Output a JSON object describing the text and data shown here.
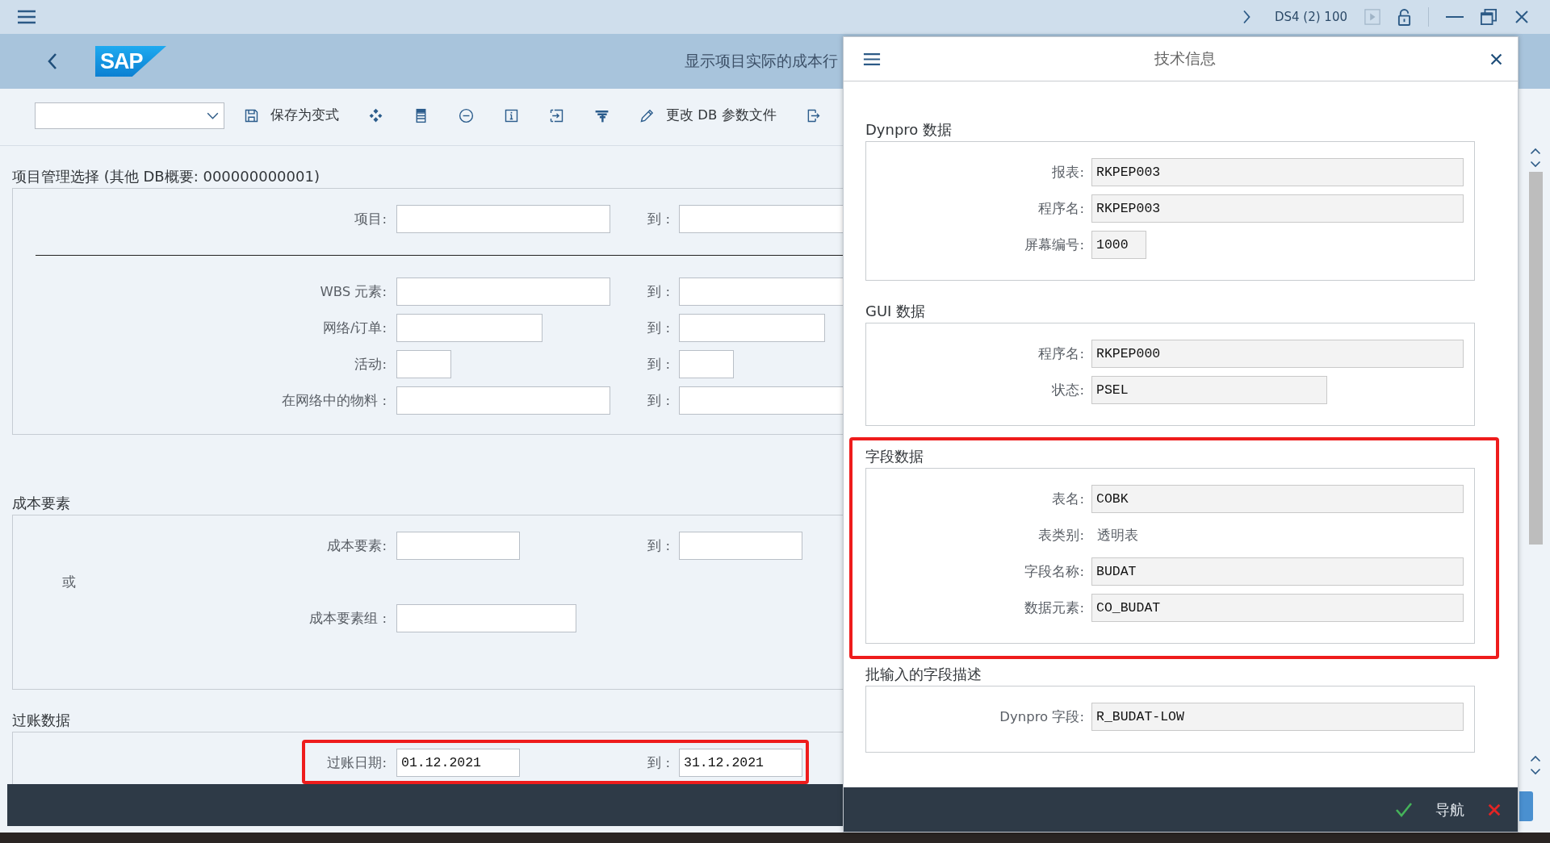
{
  "title_bar": {
    "system": "DS4 (2) 100",
    "play_button": {
      "disabled": true
    }
  },
  "header": {
    "logo": "SAP",
    "title": "显示项目实际的成本行"
  },
  "toolbar": {
    "buttons": [
      {
        "kind": "icon_text",
        "label": "保存为变式"
      },
      {
        "kind": "icon"
      },
      {
        "kind": "icon"
      },
      {
        "kind": "icon"
      },
      {
        "kind": "icon"
      },
      {
        "kind": "icon"
      },
      {
        "kind": "icon"
      },
      {
        "kind": "icon_text",
        "label": "更改 DB 参数文件"
      },
      {
        "kind": "icon"
      }
    ]
  },
  "sections": [
    {
      "title": "项目管理选择 (其他 DB概要: 000000000001)",
      "rows": [
        {
          "kind": "range",
          "label": "项目:",
          "to_label": "到 :",
          "highlighted": false
        },
        {
          "kind": "divider"
        },
        {
          "kind": "range",
          "label": "WBS 元素:",
          "to_label": "到 :",
          "highlighted": false
        },
        {
          "kind": "range",
          "label": "网络/订单:",
          "to_label": "到 :",
          "highlighted": false
        },
        {
          "kind": "range",
          "label": "活动:",
          "to_label": "到 :",
          "highlighted": false
        },
        {
          "kind": "range",
          "label": "在网络中的物料 :",
          "to_label": "到 :",
          "highlighted": false
        }
      ]
    },
    {
      "title": "成本要素",
      "rows": [
        {
          "kind": "range",
          "label": "成本要素:",
          "to_label": "到 :",
          "highlighted": false
        },
        {
          "kind": "or",
          "text": "或"
        },
        {
          "kind": "single",
          "label": "成本要素组 :",
          "highlighted": false
        }
      ]
    },
    {
      "title": "过账数据",
      "rows": [
        {
          "kind": "range",
          "label": "过账日期:",
          "value": "01.12.2021",
          "to_label": "到 :",
          "to_value": "31.12.2021",
          "highlighted": true
        }
      ]
    }
  ],
  "dialog": {
    "title": "技术信息",
    "groups": [
      {
        "title": "Dynpro 数据",
        "highlighted": false,
        "rows": [
          {
            "kind": "field",
            "label": "报表:",
            "value": "RKPEP003"
          },
          {
            "kind": "field",
            "label": "程序名:",
            "value": "RKPEP003"
          },
          {
            "kind": "field",
            "label": "屏幕编号:",
            "value": "1000"
          }
        ]
      },
      {
        "title": "GUI 数据",
        "highlighted": false,
        "rows": [
          {
            "kind": "field",
            "label": "程序名:",
            "value": "RKPEP000"
          },
          {
            "kind": "field",
            "label": "状态:",
            "value": "PSEL"
          }
        ]
      },
      {
        "title": "字段数据",
        "highlighted": true,
        "rows": [
          {
            "kind": "field",
            "label": "表名:",
            "value": "COBK"
          },
          {
            "kind": "text",
            "label": "表类别:",
            "value": "透明表"
          },
          {
            "kind": "field",
            "label": "字段名称:",
            "value": "BUDAT"
          },
          {
            "kind": "field",
            "label": "数据元素:",
            "value": "CO_BUDAT"
          }
        ]
      },
      {
        "title": "批输入的字段描述",
        "highlighted": false,
        "rows": [
          {
            "kind": "field",
            "label": "Dynpro 字段:",
            "value": "R_BUDAT-LOW"
          }
        ]
      }
    ],
    "footer_buttons": [
      {
        "kind": "confirm"
      },
      {
        "kind": "text",
        "label": "导航"
      },
      {
        "kind": "cancel"
      }
    ]
  }
}
